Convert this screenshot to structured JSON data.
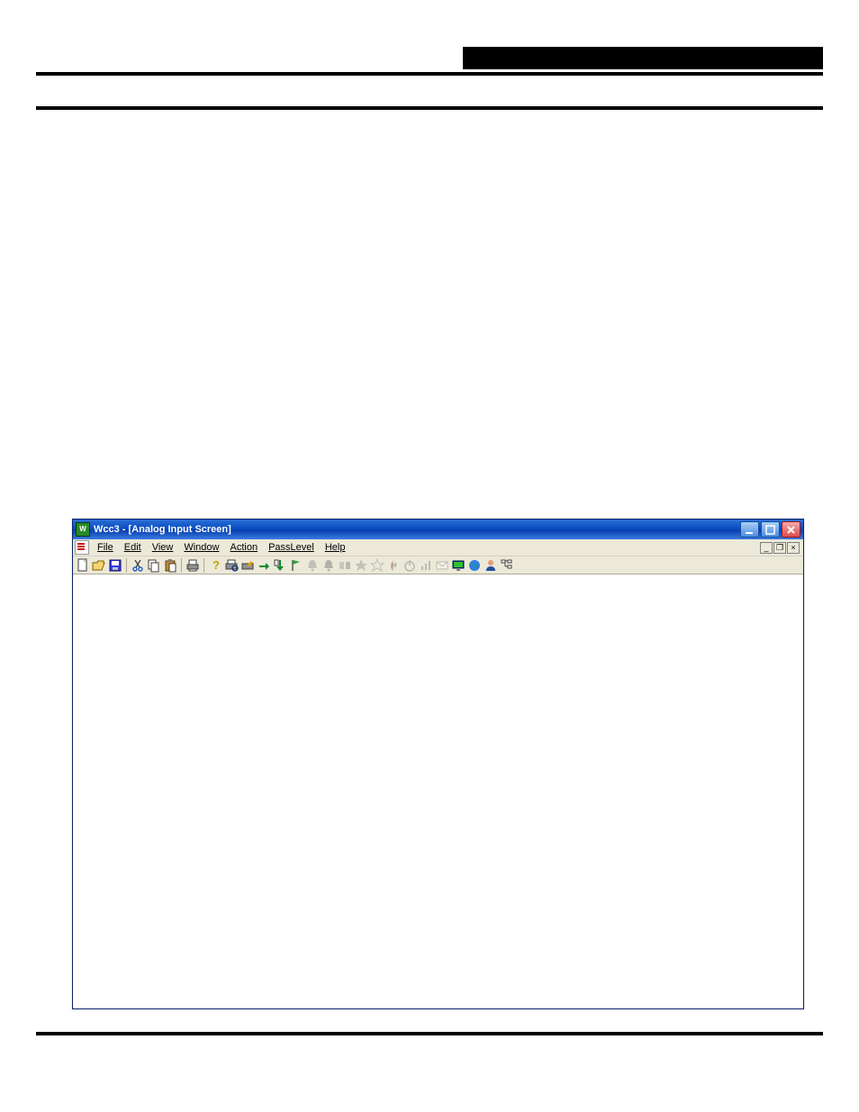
{
  "window": {
    "title": "Wcc3 - [Analog Input Screen]",
    "app_icon_letter": "W"
  },
  "window_controls": {
    "minimize": "Minimize",
    "maximize": "Maximize",
    "close": "Close"
  },
  "mdi_controls": {
    "minimize": "Minimize child",
    "restore": "Restore child",
    "close": "Close child"
  },
  "menubar": {
    "items": [
      {
        "label": "File"
      },
      {
        "label": "Edit"
      },
      {
        "label": "View"
      },
      {
        "label": "Window"
      },
      {
        "label": "Action"
      },
      {
        "label": "PassLevel"
      },
      {
        "label": "Help"
      }
    ]
  },
  "toolbar": {
    "items": [
      {
        "name": "new-icon",
        "enabled": true
      },
      {
        "name": "open-icon",
        "enabled": true
      },
      {
        "name": "save-icon",
        "enabled": true
      },
      {
        "sep": true
      },
      {
        "name": "cut-icon",
        "enabled": true
      },
      {
        "name": "copy-icon",
        "enabled": true
      },
      {
        "name": "paste-icon",
        "enabled": true
      },
      {
        "sep": true
      },
      {
        "name": "print-icon",
        "enabled": true
      },
      {
        "sep": true
      },
      {
        "name": "help-icon",
        "enabled": true
      },
      {
        "name": "print-preview-icon",
        "enabled": true
      },
      {
        "name": "print-setup-icon",
        "enabled": true
      },
      {
        "name": "arrow-right-icon",
        "enabled": true
      },
      {
        "name": "arrow-down-icon",
        "enabled": true
      },
      {
        "name": "flag-icon",
        "enabled": true
      },
      {
        "name": "bell-icon",
        "enabled": false
      },
      {
        "name": "bell-alt-icon",
        "enabled": false
      },
      {
        "name": "toggle-icon",
        "enabled": false
      },
      {
        "name": "star-icon",
        "enabled": false
      },
      {
        "name": "star-outline-icon",
        "enabled": false
      },
      {
        "name": "fire-icon",
        "enabled": false
      },
      {
        "name": "onoff-icon",
        "enabled": false
      },
      {
        "name": "chart-icon",
        "enabled": false
      },
      {
        "name": "mail-icon",
        "enabled": false
      },
      {
        "name": "monitor-icon",
        "enabled": true
      },
      {
        "name": "globe-icon",
        "enabled": true
      },
      {
        "name": "person-icon",
        "enabled": true
      },
      {
        "name": "tree-icon",
        "enabled": true
      }
    ]
  }
}
